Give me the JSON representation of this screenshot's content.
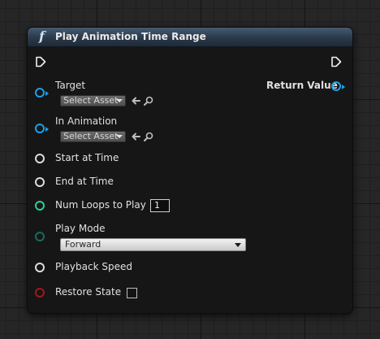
{
  "node": {
    "title": "Play Animation Time Range",
    "function_icon": "function-icon",
    "output_label": "Return Value",
    "colors": {
      "object_pin": "#1e9fe6",
      "float_pin": "#d9d9d9",
      "int_pin": "#27d29a",
      "enum_pin": "#1a6a5c",
      "bool_pin": "#a01818",
      "header": "#2a394a"
    }
  },
  "pins": {
    "target": {
      "label": "Target",
      "asset_select": "Select Asset",
      "icons": [
        "browse-arrow-icon",
        "search-icon"
      ]
    },
    "in_animation": {
      "label": "In Animation",
      "asset_select": "Select Asset",
      "icons": [
        "browse-arrow-icon",
        "search-icon"
      ]
    },
    "start_at_time": {
      "label": "Start at Time"
    },
    "end_at_time": {
      "label": "End at Time"
    },
    "num_loops": {
      "label": "Num Loops to Play",
      "value": "1"
    },
    "play_mode": {
      "label": "Play Mode",
      "selected": "Forward"
    },
    "playback_speed": {
      "label": "Playback Speed"
    },
    "restore_state": {
      "label": "Restore State",
      "checked": false
    }
  }
}
